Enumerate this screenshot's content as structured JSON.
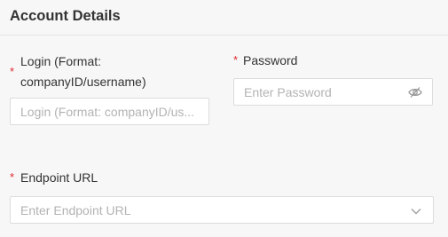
{
  "section": {
    "title": "Account Details"
  },
  "fields": {
    "login": {
      "required_mark": "*",
      "label_line1": "Login (Format:",
      "label_line2": "companyID/username)",
      "placeholder": "Login (Format: companyID/us..."
    },
    "password": {
      "required_mark": "*",
      "label": "Password",
      "placeholder": "Enter Password",
      "icon": "eye-off-icon"
    },
    "endpoint": {
      "required_mark": "*",
      "label": "Endpoint URL",
      "placeholder": "Enter Endpoint URL",
      "icon": "chevron-down-icon"
    }
  },
  "colors": {
    "required": "#e0282e",
    "border": "#dcdcdc",
    "placeholder": "#b3b3b3",
    "background": "#f7f7f7"
  }
}
